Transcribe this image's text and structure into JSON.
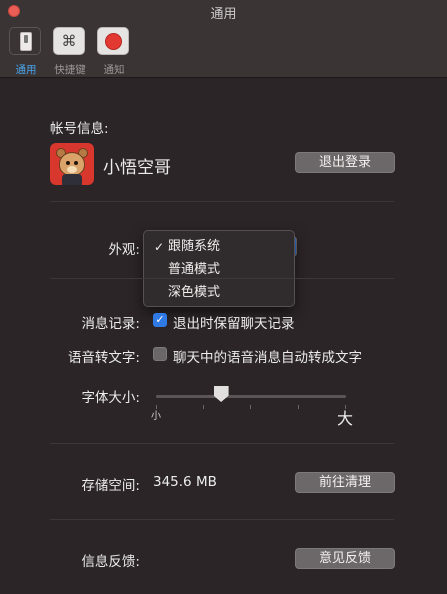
{
  "window": {
    "title": "通用"
  },
  "toolbar": {
    "items": [
      {
        "label": "通用",
        "icon": "toggle-switch-icon",
        "active": true
      },
      {
        "label": "快捷键",
        "icon": "command-key-icon",
        "glyph": "⌘",
        "active": false
      },
      {
        "label": "通知",
        "icon": "record-dot-icon",
        "active": false
      }
    ]
  },
  "account": {
    "section_label": "帐号信息:",
    "username": "小悟空哥",
    "avatar_icon": "bear-avatar",
    "logout_label": "退出登录"
  },
  "appearance": {
    "label": "外观:",
    "options": [
      "跟随系统",
      "普通模式",
      "深色模式"
    ],
    "selected": "跟随系统",
    "dropdown_open": true
  },
  "chat_history": {
    "label": "消息记录:",
    "checkbox_label": "退出时保留聊天记录",
    "checked": true
  },
  "voice_to_text": {
    "label": "语音转文字:",
    "checkbox_label": "聊天中的语音消息自动转成文字",
    "checked": false
  },
  "font_size": {
    "label": "字体大小:",
    "min_label": "小",
    "max_label": "大",
    "value_fraction": 0.34,
    "tick_count": 5
  },
  "storage": {
    "label": "存储空间:",
    "value": "345.6 MB",
    "clean_label": "前往清理"
  },
  "feedback": {
    "label": "信息反馈:",
    "button_label": "意见反馈"
  },
  "colors": {
    "background": "#2c2527",
    "accent": "#2f7ae5",
    "active_tab": "#49a4e9",
    "close_button": "#ec5f56"
  }
}
